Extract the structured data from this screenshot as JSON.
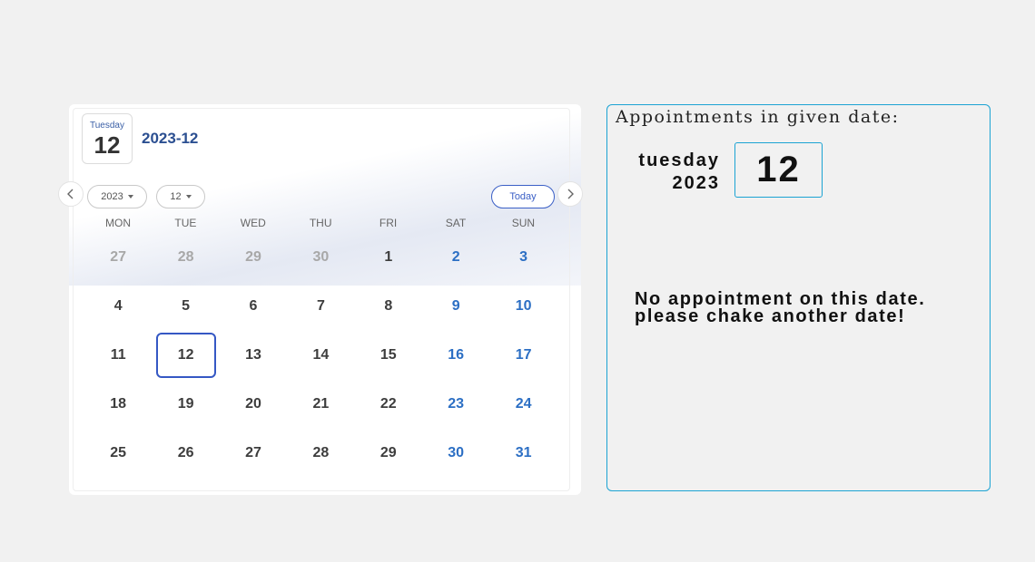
{
  "calendar": {
    "chip": {
      "weekday": "Tuesday",
      "day": "12"
    },
    "title": "2023-12",
    "year_select": "2023",
    "month_select": "12",
    "today_label": "Today",
    "weekdays": [
      "MON",
      "TUE",
      "WED",
      "THU",
      "FRI",
      "SAT",
      "SUN"
    ],
    "weeks": [
      [
        {
          "d": "27",
          "m": true
        },
        {
          "d": "28",
          "m": true
        },
        {
          "d": "29",
          "m": true
        },
        {
          "d": "30",
          "m": true
        },
        {
          "d": "1"
        },
        {
          "d": "2"
        },
        {
          "d": "3"
        }
      ],
      [
        {
          "d": "4"
        },
        {
          "d": "5"
        },
        {
          "d": "6"
        },
        {
          "d": "7"
        },
        {
          "d": "8"
        },
        {
          "d": "9"
        },
        {
          "d": "10"
        }
      ],
      [
        {
          "d": "11"
        },
        {
          "d": "12",
          "sel": true
        },
        {
          "d": "13"
        },
        {
          "d": "14"
        },
        {
          "d": "15"
        },
        {
          "d": "16"
        },
        {
          "d": "17"
        }
      ],
      [
        {
          "d": "18"
        },
        {
          "d": "19"
        },
        {
          "d": "20"
        },
        {
          "d": "21"
        },
        {
          "d": "22"
        },
        {
          "d": "23"
        },
        {
          "d": "24"
        }
      ],
      [
        {
          "d": "25"
        },
        {
          "d": "26"
        },
        {
          "d": "27"
        },
        {
          "d": "28"
        },
        {
          "d": "29"
        },
        {
          "d": "30"
        },
        {
          "d": "31"
        }
      ]
    ]
  },
  "appointments": {
    "title": "Appointments in given date:",
    "weekday": "tuesday",
    "year": "2023",
    "day": "12",
    "message_line1": "No appointment on this date.",
    "message_line2": "please chake another date!"
  },
  "colors": {
    "accent": "#3558c4",
    "weekend": "#2c6fc4",
    "panel_border": "#1ba3d3"
  }
}
